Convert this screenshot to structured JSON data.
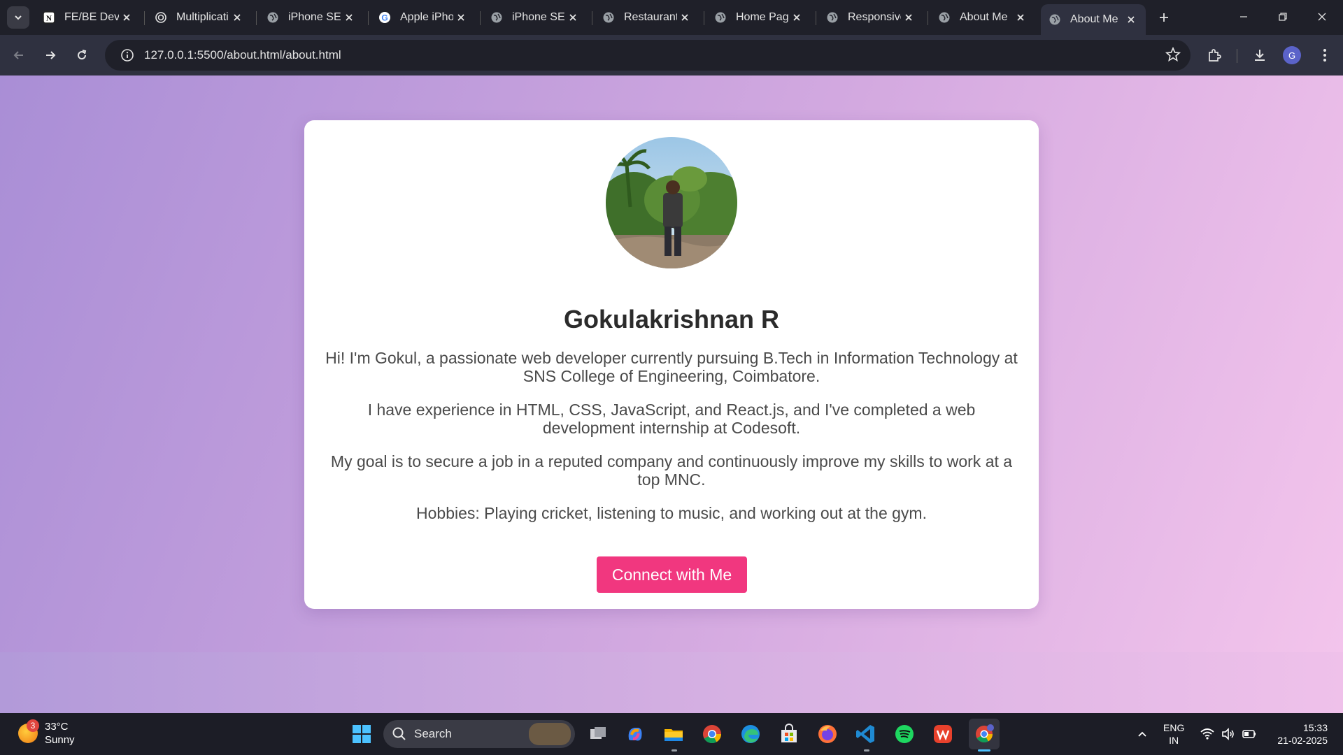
{
  "browser": {
    "tabs": [
      {
        "title": "FE/BE Dev",
        "icon": "notion-icon"
      },
      {
        "title": "Multiplicati",
        "icon": "openai-icon"
      },
      {
        "title": "iPhone SE",
        "icon": "globe-icon"
      },
      {
        "title": "Apple iPho",
        "icon": "google-icon"
      },
      {
        "title": "iPhone SE",
        "icon": "globe-icon"
      },
      {
        "title": "Restaurant",
        "icon": "globe-icon"
      },
      {
        "title": "Home Pag",
        "icon": "globe-icon"
      },
      {
        "title": "Responsive",
        "icon": "globe-icon"
      },
      {
        "title": "About Me",
        "icon": "globe-icon"
      },
      {
        "title": "About Me",
        "icon": "globe-icon",
        "active": true
      }
    ],
    "url": "127.0.0.1:5500/about.html/about.html",
    "profile_initial": "G"
  },
  "page": {
    "name": "Gokulakrishnan R",
    "paragraphs": [
      "Hi! I'm Gokul, a passionate web developer currently pursuing B.Tech in Information Technology at SNS College of Engineering, Coimbatore.",
      "I have experience in HTML, CSS, JavaScript, and React.js, and I've completed a web development internship at Codesoft.",
      "My goal is to secure a job in a reputed company and continuously improve my skills to work at a top MNC.",
      "Hobbies: Playing cricket, listening to music, and working out at the gym."
    ],
    "cta_label": "Connect with Me",
    "colors": {
      "accent": "#f1377f",
      "gradient_start": "#a98ed6",
      "gradient_end": "#f4c5ec"
    }
  },
  "taskbar": {
    "weather_temp": "33°C",
    "weather_desc": "Sunny",
    "weather_badge": "3",
    "search_label": "Search",
    "lang_line1": "ENG",
    "lang_line2": "IN",
    "time": "15:33",
    "date": "21-02-2025"
  }
}
